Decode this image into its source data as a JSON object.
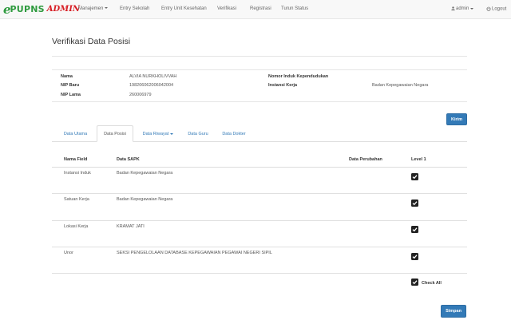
{
  "navbar": {
    "brand_e": "e",
    "brand_pupns": "PUPNS",
    "brand_admin": "ADMIN",
    "items": [
      {
        "label": "Manajemen"
      },
      {
        "label": "Entry Sekolah"
      },
      {
        "label": "Entry Unit Kesehatan"
      },
      {
        "label": "Verifikasi"
      },
      {
        "label": "Registrasi"
      },
      {
        "label": "Turun Status"
      }
    ],
    "user_label": "admin",
    "logout_label": "Logout"
  },
  "page_title": "Verifikasi Data Posisi",
  "profile": {
    "nama_label": "Nama",
    "nama_value": "ALVIA NURKHOLIVVAH",
    "nip_baru_label": "NIP Baru",
    "nip_baru_value": "198206062006042004",
    "nip_lama_label": "NIP Lama",
    "nip_lama_value": "260006979",
    "nik_label": "Nomor Induk Kependudukan",
    "nik_value": "",
    "instansi_label": "Instansi Kerja",
    "instansi_value": "Badan Kepegawaian Negara"
  },
  "kirim_label": "Kirim",
  "tabs": [
    {
      "label": "Data Utama"
    },
    {
      "label": "Data Posisi"
    },
    {
      "label": "Data Riwayat"
    },
    {
      "label": "Data Guru"
    },
    {
      "label": "Data Dokter"
    }
  ],
  "table": {
    "headers": [
      "Nama Field",
      "Data SAPK",
      "Data Perubahan",
      "Level 1"
    ],
    "rows": [
      {
        "field": "Instansi Induk",
        "sapk": "Badan Kepegawaian Negara",
        "perubahan": "",
        "checked": true
      },
      {
        "field": "Satuan Kerja",
        "sapk": "Badan Kepegawaian Negara",
        "perubahan": "",
        "checked": true
      },
      {
        "field": "Lokasi Kerja",
        "sapk": "KRAMAT JATI",
        "perubahan": "",
        "checked": true
      },
      {
        "field": "Unor",
        "sapk": "SEKSI PENGELOLAAN DATABASE KEPEGAWAIAN PEGAWAI NEGERI SIPIL",
        "perubahan": "",
        "checked": true
      }
    ],
    "check_all_label": "Check All"
  },
  "simpan_label": "Simpan",
  "colors": {
    "primary": "#337ab7",
    "brand_green": "#2e9a3e",
    "brand_red": "#d71d24",
    "checkbox": "#222222"
  }
}
